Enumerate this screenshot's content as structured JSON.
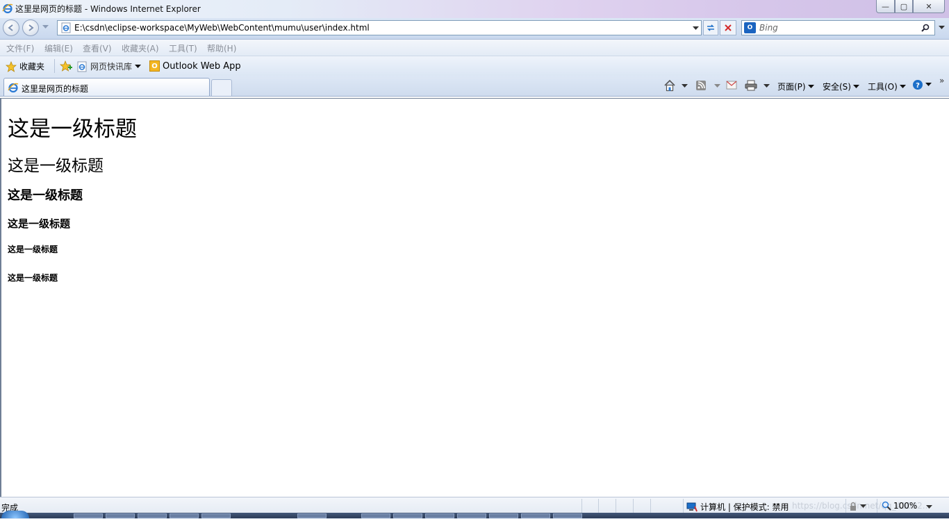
{
  "window": {
    "title": "这里是网页的标题 - Windows Internet Explorer",
    "minimize_glyph": "—",
    "maximize_glyph": "▢",
    "close_glyph": "✕"
  },
  "navbar": {
    "address": "E:\\csdn\\eclipse-workspace\\MyWeb\\WebContent\\mumu\\user\\index.html",
    "search_placeholder": "Bing"
  },
  "menubar": {
    "items": [
      "文件(F)",
      "编辑(E)",
      "查看(V)",
      "收藏夹(A)",
      "工具(T)",
      "帮助(H)"
    ]
  },
  "favorites": {
    "favorites_label": "收藏夹",
    "web_slice_label": "网页快讯库",
    "outlook_label": "Outlook Web App"
  },
  "tabs": {
    "active_label": "这里是网页的标题"
  },
  "commandbar": {
    "page_label": "页面(P)",
    "safety_label": "安全(S)",
    "tools_label": "工具(O)"
  },
  "content": {
    "h1": "这是一级标题",
    "h2": "这是一级标题",
    "h3": "这是一级标题",
    "h4": "这是一级标题",
    "h5": "这是一级标题",
    "h6": "这是一级标题"
  },
  "statusbar": {
    "status": "完成",
    "zone": "计算机 | 保护模式: 禁用",
    "zoom": "100%",
    "watermark": "https://blog.csdn.net/qq_41082..."
  },
  "colors": {
    "accent": "#1c6fc9",
    "close_red": "#d42a2a"
  }
}
